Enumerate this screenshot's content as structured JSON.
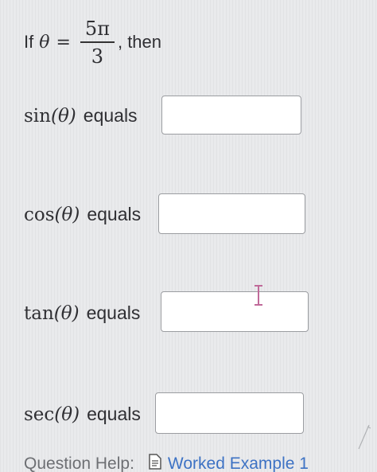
{
  "question": {
    "prefix": "If",
    "variable": "θ",
    "equals_sign": "=",
    "numerator": "5π",
    "denominator": "3",
    "suffix": ", then"
  },
  "rows": [
    {
      "function": "sin",
      "arg": "(θ)",
      "word": "equals",
      "value": ""
    },
    {
      "function": "cos",
      "arg": "(θ)",
      "word": "equals",
      "value": ""
    },
    {
      "function": "tan",
      "arg": "(θ)",
      "word": "equals",
      "value": ""
    },
    {
      "function": "sec",
      "arg": "(θ)",
      "word": "equals",
      "value": ""
    }
  ],
  "help": {
    "label": "Question Help:",
    "link_label": "Worked Example 1",
    "link_icon": "document-icon"
  },
  "colors": {
    "background": "#e9eaec",
    "box_border": "#9b9da1",
    "link": "#3d72c4"
  }
}
